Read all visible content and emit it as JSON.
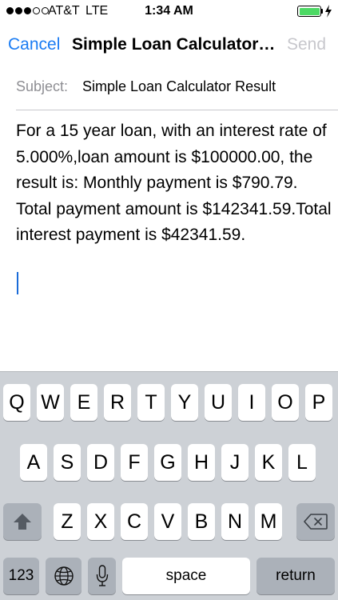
{
  "status_bar": {
    "carrier": "AT&T",
    "network": "LTE",
    "time": "1:34 AM",
    "signal_bars_filled": 3,
    "signal_bars_total": 5,
    "battery_icon": "battery-charging-icon"
  },
  "nav": {
    "cancel_label": "Cancel",
    "title": "Simple Loan Calculator Result",
    "send_label": "Send"
  },
  "subject": {
    "label": "Subject:",
    "value": "Simple Loan Calculator Result"
  },
  "body": {
    "text": "For a 15 year loan, with an interest rate of 5.000%,loan amount is $100000.00, the result is: Monthly payment is $790.79. Total payment amount is $142341.59.Total interest payment is $42341.59."
  },
  "keyboard": {
    "row1": [
      "Q",
      "W",
      "E",
      "R",
      "T",
      "Y",
      "U",
      "I",
      "O",
      "P"
    ],
    "row2": [
      "A",
      "S",
      "D",
      "F",
      "G",
      "H",
      "J",
      "K",
      "L"
    ],
    "row3": [
      "Z",
      "X",
      "C",
      "V",
      "B",
      "N",
      "M"
    ],
    "numbers_label": "123",
    "space_label": "space",
    "return_label": "return",
    "shift_icon": "shift-icon",
    "delete_icon": "delete-icon",
    "globe_icon": "globe-icon",
    "mic_icon": "microphone-icon"
  },
  "colors": {
    "accent": "#1a7cf3",
    "disabled": "#c7c7cc",
    "battery": "#4cd964",
    "keyboard_bg": "#cdd1d6"
  }
}
